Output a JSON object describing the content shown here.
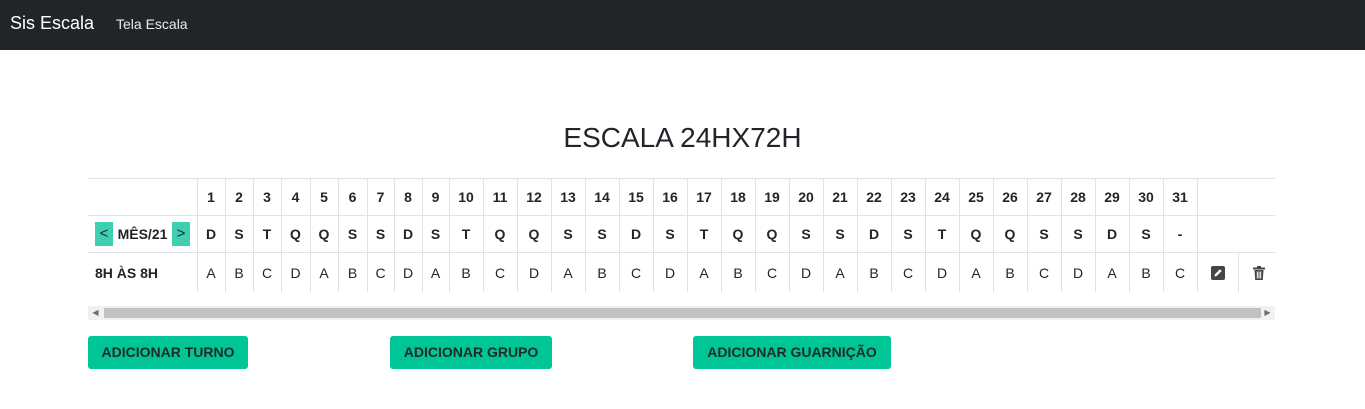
{
  "navbar": {
    "brand": "Sis Escala",
    "link": "Tela Escala"
  },
  "title": "ESCALA 24HX72H",
  "month_nav": {
    "prev": "<",
    "label": "MÊS/21",
    "next": ">"
  },
  "days": [
    "1",
    "2",
    "3",
    "4",
    "5",
    "6",
    "7",
    "8",
    "9",
    "10",
    "11",
    "12",
    "13",
    "14",
    "15",
    "16",
    "17",
    "18",
    "19",
    "20",
    "21",
    "22",
    "23",
    "24",
    "25",
    "26",
    "27",
    "28",
    "29",
    "30",
    "31"
  ],
  "weekdays": [
    "D",
    "S",
    "T",
    "Q",
    "Q",
    "S",
    "S",
    "D",
    "S",
    "T",
    "Q",
    "Q",
    "S",
    "S",
    "D",
    "S",
    "T",
    "Q",
    "Q",
    "S",
    "S",
    "D",
    "S",
    "T",
    "Q",
    "Q",
    "S",
    "S",
    "D",
    "S",
    "-"
  ],
  "shifts": [
    {
      "label": "8H ÀS 8H",
      "groups": [
        "A",
        "B",
        "C",
        "D",
        "A",
        "B",
        "C",
        "D",
        "A",
        "B",
        "C",
        "D",
        "A",
        "B",
        "C",
        "D",
        "A",
        "B",
        "C",
        "D",
        "A",
        "B",
        "C",
        "D",
        "A",
        "B",
        "C",
        "D",
        "A",
        "B",
        "C"
      ]
    }
  ],
  "icons": {
    "edit": "edit-icon",
    "delete": "trash-icon"
  },
  "buttons": {
    "add_turno": "ADICIONAR TURNO",
    "add_grupo": "ADICIONAR GRUPO",
    "add_guarnicao": "ADICIONAR GUARNIÇÃO"
  },
  "colors": {
    "navbar": "#212529",
    "accent": "#00c596",
    "month_arrow": "#3ecfb1"
  }
}
